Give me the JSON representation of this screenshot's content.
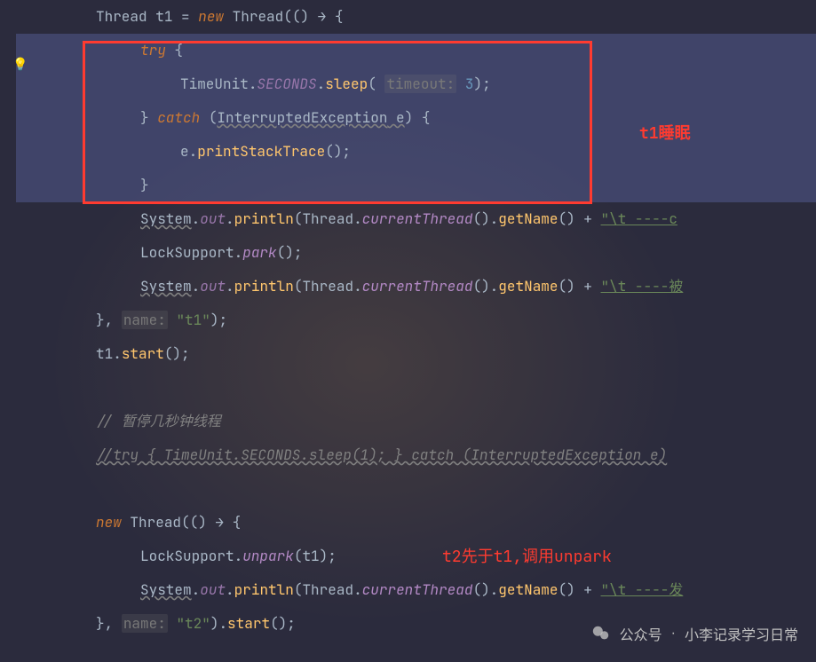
{
  "annotations": {
    "box_label": "t1睡眠",
    "t2_label": "t2先于t1,调用unpark"
  },
  "watermark": {
    "source": "公众号",
    "name": "小李记录学习日常"
  },
  "hints": {
    "timeout": "timeout:",
    "name": "name:"
  },
  "code": {
    "l1_thread": "Thread",
    "l1_var": "t1",
    "l1_eq": " = ",
    "l1_new": "new",
    "l1_thread2": " Thread(() → {",
    "l2_try": "try",
    "l2_brace": " {",
    "l3_timeunit": "TimeUnit",
    "l3_dot1": ".",
    "l3_seconds": "SECONDS",
    "l3_dot2": ".",
    "l3_sleep": "sleep",
    "l3_paren": "( ",
    "l3_num": "3",
    "l3_end": ");",
    "l4_brace": "} ",
    "l4_catch": "catch",
    "l4_paren": " (",
    "l4_ex": "InterruptedException",
    "l4_e": " e",
    "l4_end": ") {",
    "l5_e": "e",
    "l5_dot": ".",
    "l5_method": "printStackTrace",
    "l5_end": "();",
    "l6_brace": "}",
    "l7_sys": "System",
    "l7_dot1": ".",
    "l7_out": "out",
    "l7_dot2": ".",
    "l7_println": "println",
    "l7_paren": "(",
    "l7_thread": "Thread",
    "l7_dot3": ".",
    "l7_cur": "currentThread",
    "l7_paren2": "().",
    "l7_getname": "getName",
    "l7_paren3": "() + ",
    "l7_str": "\"\\t ----c",
    "l8_lock": "LockSupport",
    "l8_dot": ".",
    "l8_park": "park",
    "l8_end": "();",
    "l9_str": "\"\\t ----被",
    "l10_brace": "}, ",
    "l10_str": "\"t1\"",
    "l10_end": ");",
    "l11_t1": "t1",
    "l11_dot": ".",
    "l11_start": "start",
    "l11_end": "();",
    "l12_comment": "// 暂停几秒钟线程",
    "l13_comment": "//try { TimeUnit.SECONDS.sleep(1); } catch (InterruptedException e)",
    "l14_new": "new",
    "l14_thread": " Thread(() → {",
    "l15_lock": "LockSupport",
    "l15_dot": ".",
    "l15_unpark": "unpark",
    "l15_paren": "(",
    "l15_t1": "t1",
    "l15_end": ");",
    "l16_str": "\"\\t ----发",
    "l17_brace": "}, ",
    "l17_str": "\"t2\"",
    "l17_end": ").",
    "l17_start": "start",
    "l17_end2": "();"
  }
}
